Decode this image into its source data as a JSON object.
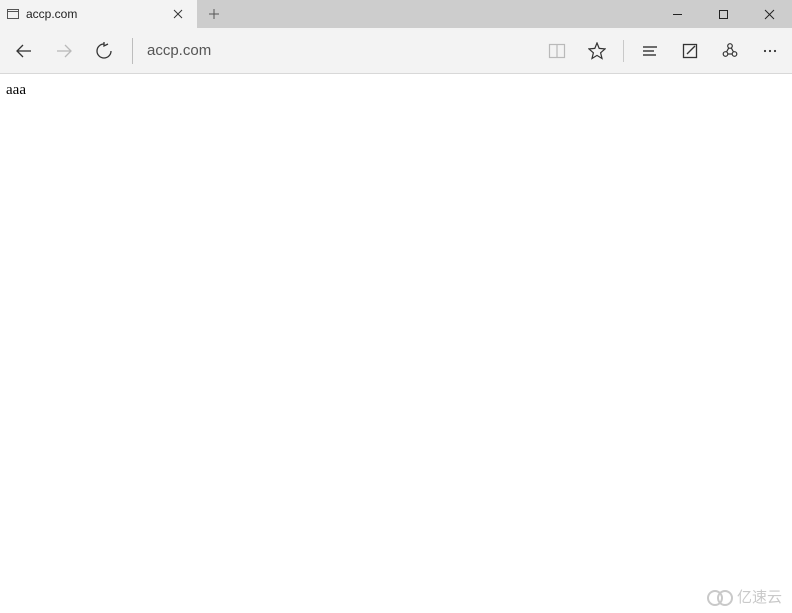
{
  "tab": {
    "title": "accp.com"
  },
  "address": {
    "value": "accp.com"
  },
  "page": {
    "body_text": "aaa"
  },
  "watermark": {
    "text": "亿速云"
  }
}
